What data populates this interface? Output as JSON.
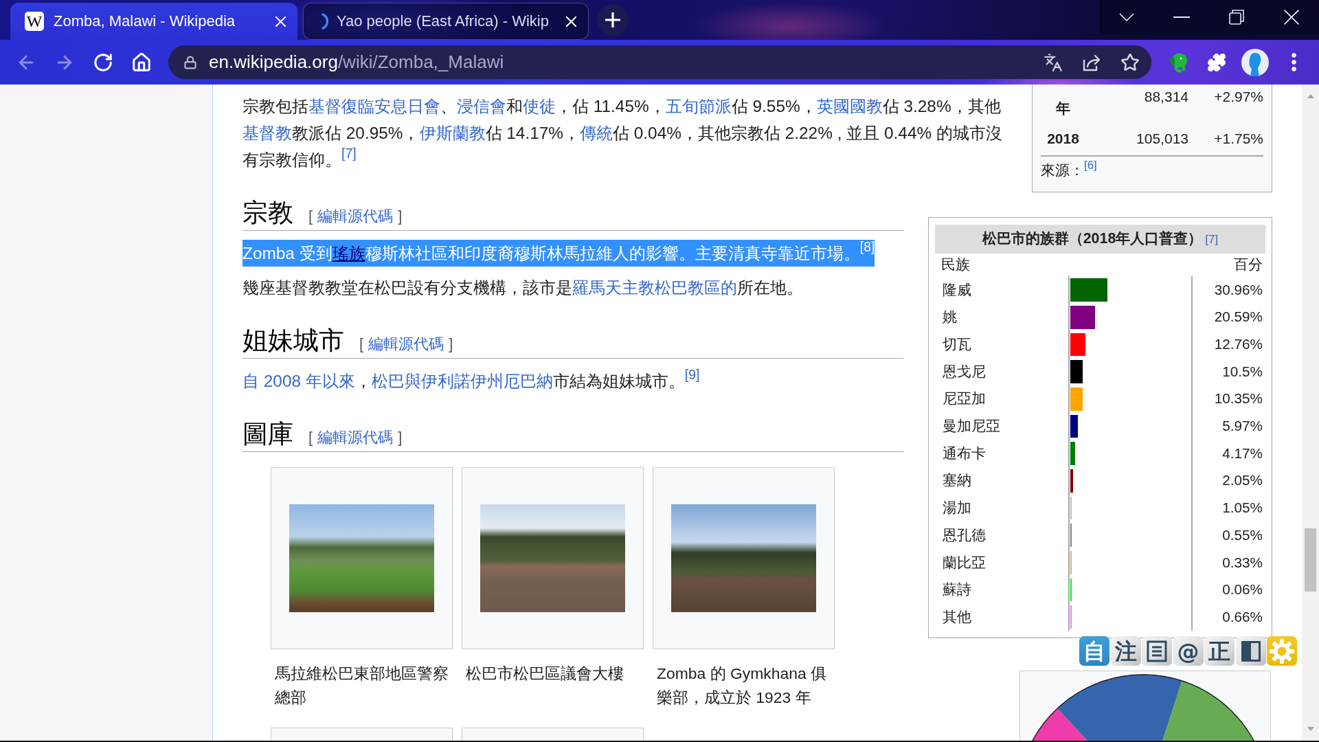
{
  "browser": {
    "tabs": [
      {
        "title": "Zomba, Malawi - Wikipedia",
        "favicon": {
          "kind": "letter",
          "text": "W"
        },
        "selected": true
      },
      {
        "title": "Yao people (East Africa) - Wikip",
        "favicon": {
          "kind": "spinner"
        },
        "selected": false
      }
    ],
    "nav_buttons": [
      {
        "kind": "back",
        "disabled": true
      },
      {
        "kind": "forward",
        "disabled": true
      },
      {
        "kind": "reload",
        "disabled": false
      },
      {
        "kind": "home",
        "disabled": false
      }
    ],
    "address": {
      "host": "en.wikipedia.org",
      "path": "/wiki/Zomba,_Malawi"
    }
  },
  "population_table": {
    "rows": [
      {
        "year": "年",
        "population": "88,314",
        "change": "+2.97%"
      },
      {
        "year": "2018",
        "population": "105,013",
        "change": "+1.75%"
      }
    ],
    "source_label": "來源：",
    "source_ref": "[6]"
  },
  "ethnic_table": {
    "title": "松巴市的族群（2018年人口普查）",
    "title_ref": "[7]",
    "columns": [
      "民族",
      "百分"
    ],
    "rows": [
      {
        "group": "隆威",
        "percent": "30.96%",
        "level": 0.3096,
        "color": "#006400"
      },
      {
        "group": "姚",
        "percent": "20.59%",
        "level": 0.2059,
        "color": "#800080"
      },
      {
        "group": "切瓦",
        "percent": "12.76%",
        "level": 0.1276,
        "color": "#ff0000"
      },
      {
        "group": "恩戈尼",
        "percent": "10.5%",
        "level": 0.105,
        "color": "#000000"
      },
      {
        "group": "尼亞加",
        "percent": "10.35%",
        "level": 0.1035,
        "color": "#ffa500"
      },
      {
        "group": "曼加尼亞",
        "percent": "5.97%",
        "level": 0.0597,
        "color": "#000080"
      },
      {
        "group": "通布卡",
        "percent": "4.17%",
        "level": 0.0417,
        "color": "#008000"
      },
      {
        "group": "塞納",
        "percent": "2.05%",
        "level": 0.0205,
        "color": "#800000"
      },
      {
        "group": "湯加",
        "percent": "1.05%",
        "level": 0.0105,
        "color": "#c0c0c0"
      },
      {
        "group": "恩孔德",
        "percent": "0.55%",
        "level": 0.0055,
        "color": "#808080"
      },
      {
        "group": "蘭比亞",
        "percent": "0.33%",
        "level": 0.0033,
        "color": "#d2b48c"
      },
      {
        "group": "蘇詩",
        "percent": "0.06%",
        "level": 0.0006,
        "color": "#00ff00"
      },
      {
        "group": "其他",
        "percent": "0.66%",
        "level": 0.0066,
        "color": "#ee82ee"
      }
    ]
  },
  "article": {
    "lead_paragraphs": [
      {
        "selected": false,
        "segments": [
          {
            "kind": "text",
            "text": "宗教包括"
          },
          {
            "kind": "link",
            "text": "基督復臨安息日會",
            "hovered": false
          },
          {
            "kind": "text",
            "text": "、"
          },
          {
            "kind": "link",
            "text": "浸信會",
            "hovered": false
          },
          {
            "kind": "text",
            "text": "和"
          },
          {
            "kind": "link",
            "text": "使徒",
            "hovered": false
          },
          {
            "kind": "text",
            "text": "，佔 11.45%，"
          },
          {
            "kind": "link",
            "text": "五旬節派",
            "hovered": false
          },
          {
            "kind": "text",
            "text": "佔 9.55%，"
          },
          {
            "kind": "link",
            "text": "英國國教",
            "hovered": false
          },
          {
            "kind": "text",
            "text": "佔 3.28%，其他"
          },
          {
            "kind": "link",
            "text": "基督教",
            "hovered": false
          },
          {
            "kind": "text",
            "text": "教派佔 20.95%，"
          },
          {
            "kind": "link",
            "text": "伊斯蘭教",
            "hovered": false
          },
          {
            "kind": "text",
            "text": "佔 14.17%，"
          },
          {
            "kind": "link",
            "text": "傳統",
            "hovered": false
          },
          {
            "kind": "text",
            "text": "佔 0.04%，其他宗教佔 2.22% , 並且 0.44% 的城市沒有宗教信仰。"
          },
          {
            "kind": "ref",
            "text": "[7]"
          }
        ]
      }
    ],
    "sections": [
      {
        "title": "宗教",
        "edit": {
          "open": "[",
          "label": "編輯源代碼",
          "close": "]"
        },
        "paragraphs": [
          {
            "selected": true,
            "segments": [
              {
                "kind": "text",
                "text": "Zomba 受到"
              },
              {
                "kind": "link",
                "text": "瑤族",
                "hovered": true
              },
              {
                "kind": "text",
                "text": "穆斯林社區和印度裔穆斯林馬拉維人的影響。主要清真寺靠近市場。"
              },
              {
                "kind": "ref",
                "text": "[8]"
              }
            ]
          },
          {
            "selected": false,
            "segments": [
              {
                "kind": "text",
                "text": "幾座基督教教堂在松巴設有分支機構，該市是"
              },
              {
                "kind": "link",
                "text": "羅馬天主教松巴教區的",
                "hovered": false
              },
              {
                "kind": "text",
                "text": "所在地。"
              }
            ]
          }
        ]
      },
      {
        "title": "姐妹城市",
        "edit": {
          "open": "[",
          "label": "編輯源代碼",
          "close": "]"
        },
        "paragraphs": [
          {
            "selected": false,
            "segments": [
              {
                "kind": "link",
                "text": "自 2008 年以來",
                "hovered": false
              },
              {
                "kind": "text",
                "text": "，"
              },
              {
                "kind": "link",
                "text": "松巴與伊利諾伊州厄巴納",
                "hovered": false
              },
              {
                "kind": "text",
                "text": "市結為姐妹城市。"
              },
              {
                "kind": "ref",
                "text": "[9]"
              }
            ]
          }
        ]
      },
      {
        "title": "圖庫",
        "edit": {
          "open": "[",
          "label": "編輯源代碼",
          "close": "]"
        },
        "gallery": [
          {
            "kind": "photo",
            "caption": "馬拉維松巴東部地區警察總部"
          },
          {
            "kind": "photo",
            "caption": "松巴市松巴區議會大樓"
          },
          {
            "kind": "photo",
            "caption": "Zomba 的 Gymkhana 俱樂部，成立於 1923 年"
          },
          {
            "kind": "cut_off"
          },
          {
            "kind": "cut_off"
          }
        ]
      }
    ]
  },
  "converter_toolbar": {
    "buttons": [
      {
        "kind": "glyph",
        "text": "自",
        "on": true
      },
      {
        "kind": "glyph",
        "text": "注",
        "on": false
      },
      {
        "kind": "list",
        "on": false
      },
      {
        "kind": "glyph",
        "text": "@",
        "on": false
      },
      {
        "kind": "glyph",
        "text": "正",
        "on": false
      },
      {
        "kind": "contrast",
        "on": false
      },
      {
        "kind": "settings",
        "on": false
      }
    ]
  }
}
